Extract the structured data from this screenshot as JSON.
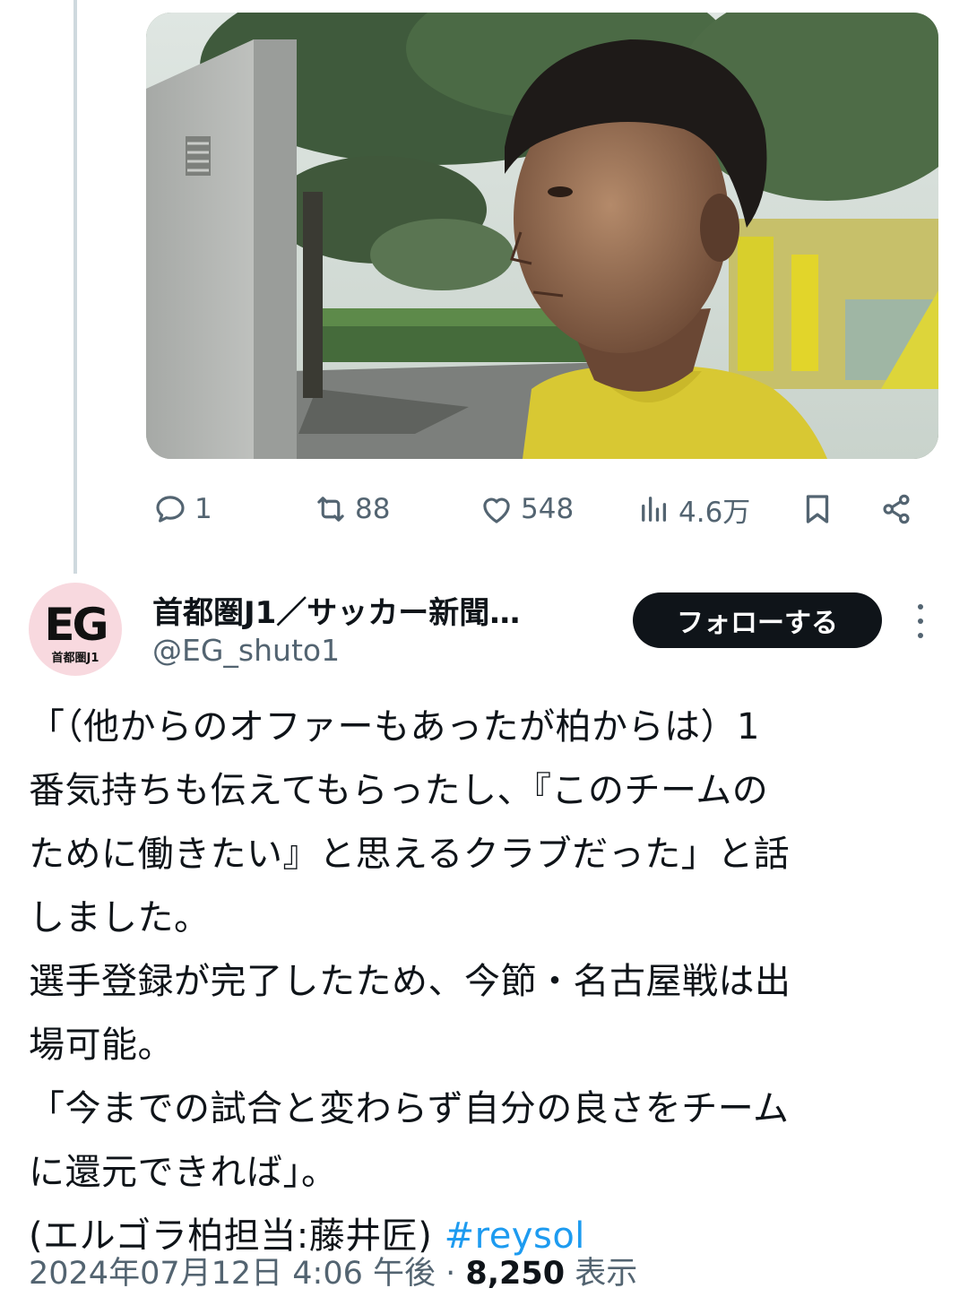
{
  "actions": {
    "reply_count": "1",
    "retweet_count": "88",
    "like_count": "548",
    "view_count": "4.6万"
  },
  "author": {
    "avatar_text": "EG",
    "avatar_sub": "首都圏J1",
    "display_name": "首都圏J1／サッカー新聞…",
    "handle": "@EG_shuto1",
    "follow_label": "フォローする"
  },
  "tweet": {
    "lines": [
      "「（他からのオファーもあったが柏からは）1",
      "番気持ちも伝えてもらったし、『このチームの",
      "ために働きたい』と思えるクラブだった」と話",
      "しました。",
      "選手登録が完了したため、今節・名古屋戦は出",
      "場可能。",
      "「今までの試合と変わらず自分の良さをチーム",
      "に還元できれば」。"
    ],
    "credit": "(エルゴラ柏担当:藤井匠) ",
    "hashtag": "#reysol"
  },
  "meta": {
    "timestamp": "2024年07月12日 4:06 午後 · ",
    "views": "8,250",
    "views_label": " 表示"
  },
  "icons": {
    "reply": "reply-icon",
    "retweet": "retweet-icon",
    "like": "heart-icon",
    "views": "analytics-icon",
    "bookmark": "bookmark-icon",
    "share": "share-icon",
    "more": "more-dots-icon"
  },
  "colors": {
    "link": "#1d9bf0",
    "follow_bg": "#0f1419",
    "secondary_text": "#536471",
    "thread_line": "#cfd9de"
  }
}
